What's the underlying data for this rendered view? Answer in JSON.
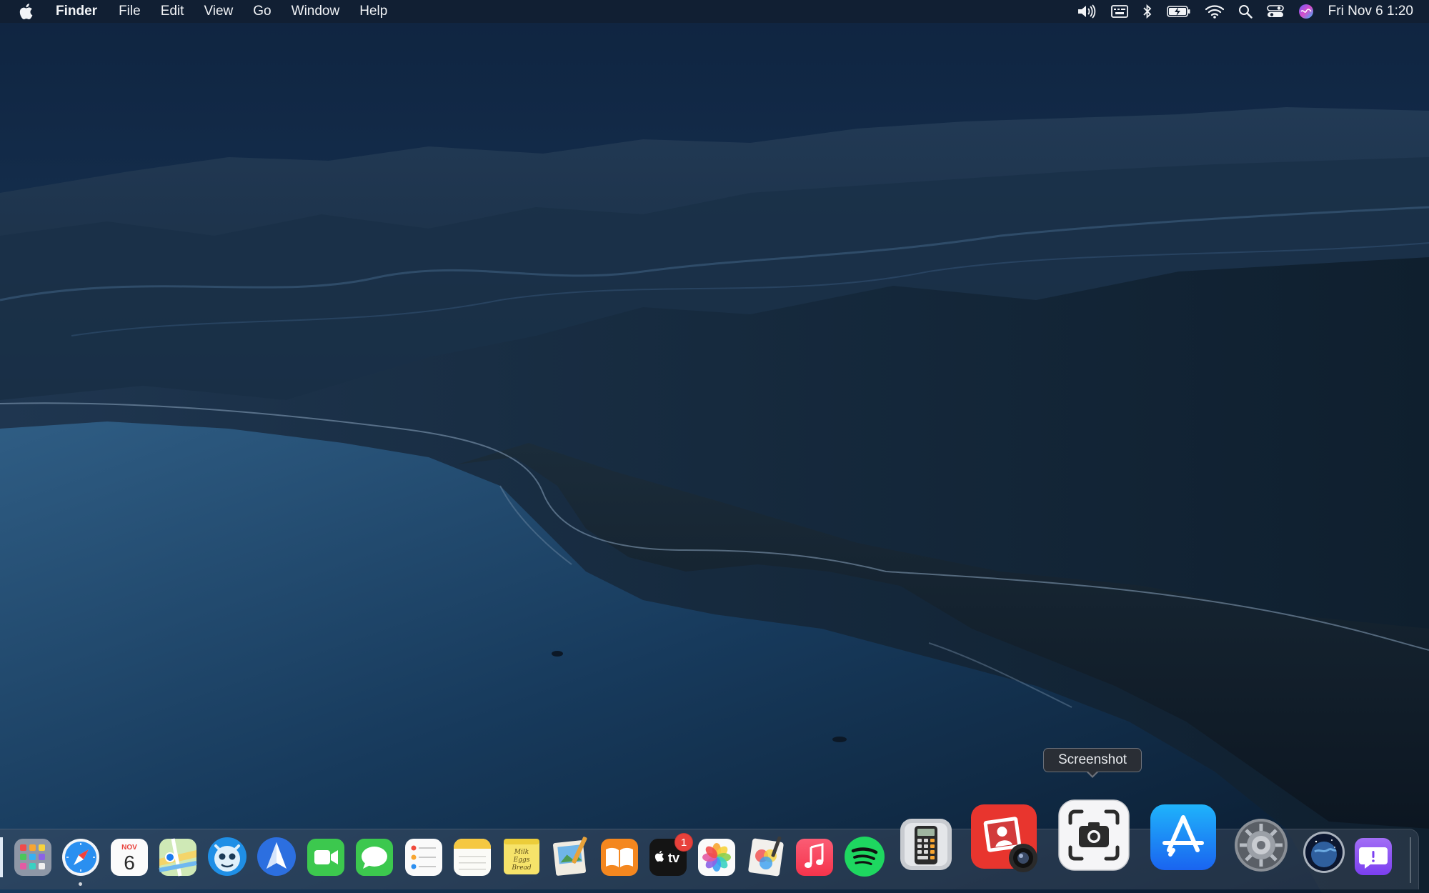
{
  "menubar": {
    "app_name": "Finder",
    "items": [
      "File",
      "Edit",
      "View",
      "Go",
      "Window",
      "Help"
    ],
    "status_icons": [
      "volume-icon",
      "keyboard-brightness-icon",
      "bluetooth-icon",
      "battery-charging-icon",
      "wifi-icon",
      "spotlight-search-icon",
      "control-center-icon",
      "siri-icon"
    ],
    "clock": "Fri Nov 6  1:20"
  },
  "dock": {
    "calendar": {
      "month": "NOV",
      "day": "6"
    },
    "apple_tv": {
      "label": "tv",
      "badge": "1"
    },
    "stickies_text": [
      "Milk",
      "Eggs",
      "Bread"
    ],
    "apps": [
      "finder",
      "launchpad",
      "safari",
      "calendar",
      "maps",
      "tweetbot",
      "spark",
      "facetime",
      "messages",
      "reminders",
      "notes",
      "stickies",
      "preview",
      "books",
      "apple-tv",
      "photos",
      "pixelmator",
      "music",
      "spotify",
      "calculator",
      "photo-booth",
      "screenshot",
      "app-store",
      "system-preferences",
      "night-sky",
      "feedback"
    ]
  },
  "tooltip": {
    "label": "Screenshot"
  },
  "colors": {
    "menubar": "#121e30",
    "accent_blue": "#1a7cf5",
    "badge": "#e8413b"
  }
}
